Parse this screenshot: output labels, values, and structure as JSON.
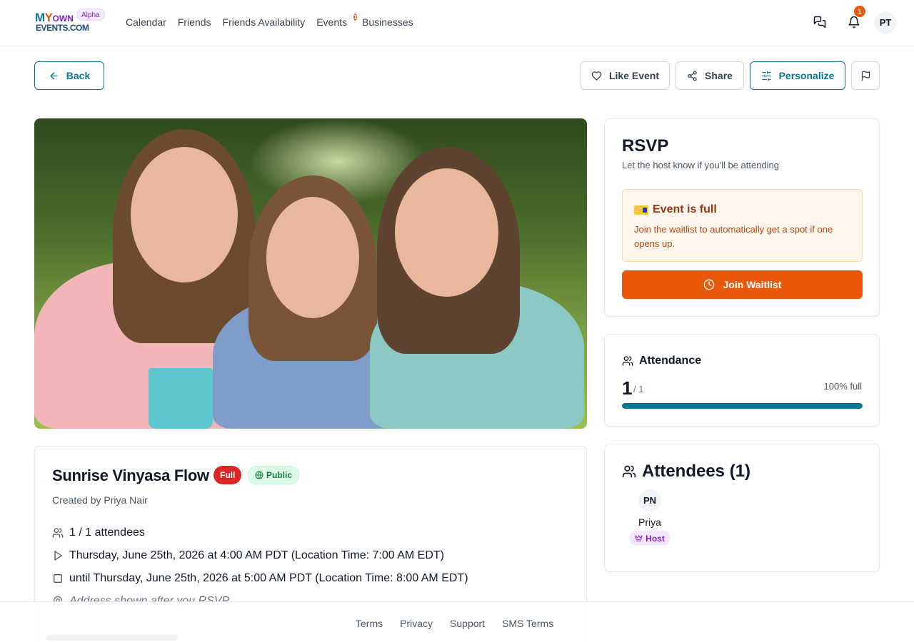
{
  "nav": {
    "logo_badge": "Alpha",
    "logo_text_top_1": "M",
    "logo_text_top_2": "Y",
    "logo_text_top_3": "OWN",
    "logo_text_bottom": "EVENTS.COM",
    "links": [
      {
        "label": "Calendar"
      },
      {
        "label": "Friends"
      },
      {
        "label": "Friends Availability"
      },
      {
        "label": "Events",
        "badge": "1"
      },
      {
        "label": "Businesses"
      }
    ],
    "notifications_badge": "1",
    "user_initials": "PT"
  },
  "actions": {
    "back_label": "Back",
    "like_label": "Like Event",
    "share_label": "Share",
    "personalize_label": "Personalize"
  },
  "rsvp": {
    "title": "RSVP",
    "subtitle": "Let the host know if you'll be attending",
    "full_title": "Event is full",
    "full_message": "Join the waitlist to automatically get a spot if one opens up.",
    "waitlist_label": "Join Waitlist"
  },
  "attendance": {
    "title": "Attendance",
    "count": "1",
    "capacity_text": "/ 1",
    "percent_text": "100% full",
    "fill_fraction": 1.0
  },
  "attendees": {
    "title": "Attendees (1)",
    "list": [
      {
        "initials": "PN",
        "name": "Priya",
        "role": "Host"
      }
    ]
  },
  "event": {
    "title": "Sunrise Vinyasa Flow",
    "status_badge": "Full",
    "visibility_badge": "Public",
    "created_by": "Created by Priya Nair",
    "attendees_text": "1 / 1 attendees",
    "start_text": "Thursday, June 25th, 2026 at 4:00 AM PDT (Location Time: 7:00 AM EDT)",
    "end_text": "until Thursday, June 25th, 2026 at 5:00 AM PDT (Location Time: 8:00 AM EDT)",
    "address_text": "Address shown after you RSVP"
  },
  "footer": {
    "links": [
      "Terms",
      "Privacy",
      "Support",
      "SMS Terms"
    ]
  },
  "colors": {
    "accent": "#0e7490",
    "orange": "#ea580c",
    "danger": "#dc2626"
  }
}
